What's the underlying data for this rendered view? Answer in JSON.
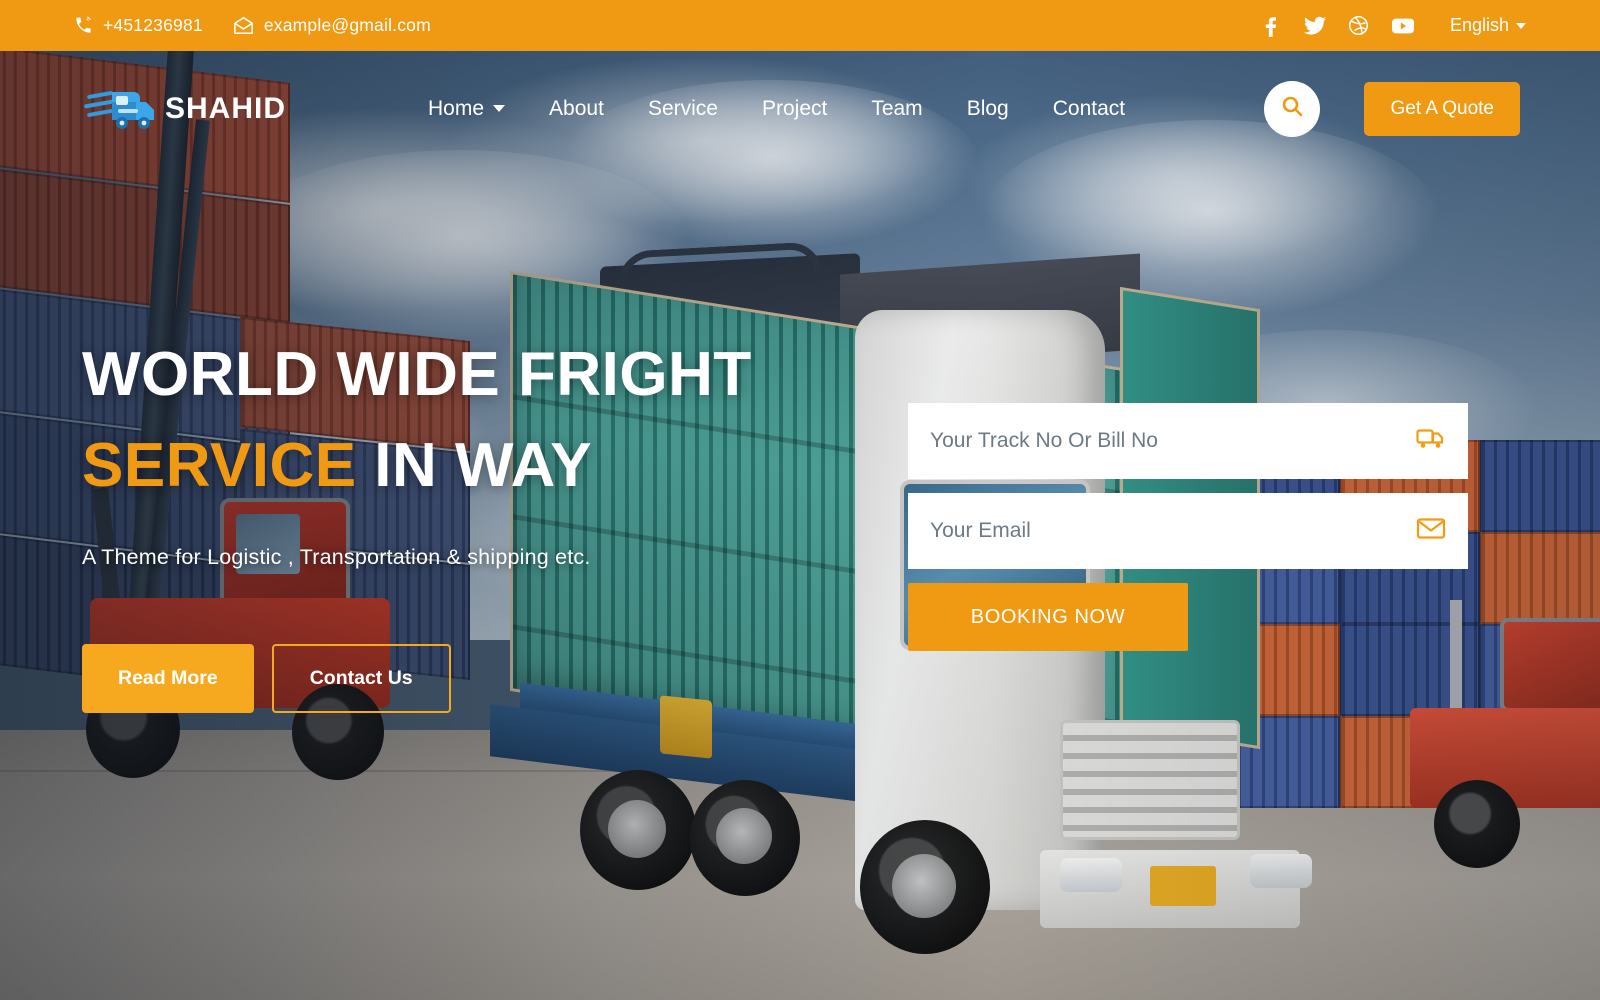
{
  "topbar": {
    "phone": "+451236981",
    "email": "example@gmail.com",
    "phone_icon": "phone-volume-icon",
    "email_icon": "envelope-open-icon",
    "socials": [
      {
        "name": "facebook-icon",
        "label": "Facebook"
      },
      {
        "name": "twitter-icon",
        "label": "Twitter"
      },
      {
        "name": "dribbble-icon",
        "label": "Dribbble"
      },
      {
        "name": "youtube-icon",
        "label": "YouTube"
      }
    ],
    "language": "English",
    "language_caret_icon": "caret-down-icon",
    "bg_color": "#F09A14"
  },
  "navbar": {
    "logo_icon": "truck-logo-icon",
    "brand": "SHAHID",
    "links": [
      {
        "label": "Home",
        "has_dropdown": true
      },
      {
        "label": "About",
        "has_dropdown": false
      },
      {
        "label": "Service",
        "has_dropdown": false
      },
      {
        "label": "Project",
        "has_dropdown": false
      },
      {
        "label": "Team",
        "has_dropdown": false
      },
      {
        "label": "Blog",
        "has_dropdown": false
      },
      {
        "label": "Contact",
        "has_dropdown": false
      }
    ],
    "search_icon": "search-icon",
    "quote_label": "Get A Quote"
  },
  "hero": {
    "title_line1": "WORLD WIDE FRIGHT",
    "title_line2_accent": "SERVICE",
    "title_line2_rest": " IN WAY",
    "subtitle": "A Theme for Logistic , Transportation & shipping etc.",
    "primary_btn": "Read More",
    "outline_btn": "Contact Us",
    "accent_color": "#F09A14"
  },
  "booking": {
    "track_placeholder": "Your Track No Or Bill No",
    "track_value": "",
    "track_icon": "truck-icon",
    "email_placeholder": "Your Email",
    "email_value": "",
    "email_icon": "envelope-icon",
    "submit_label": "BOOKING NOW"
  }
}
